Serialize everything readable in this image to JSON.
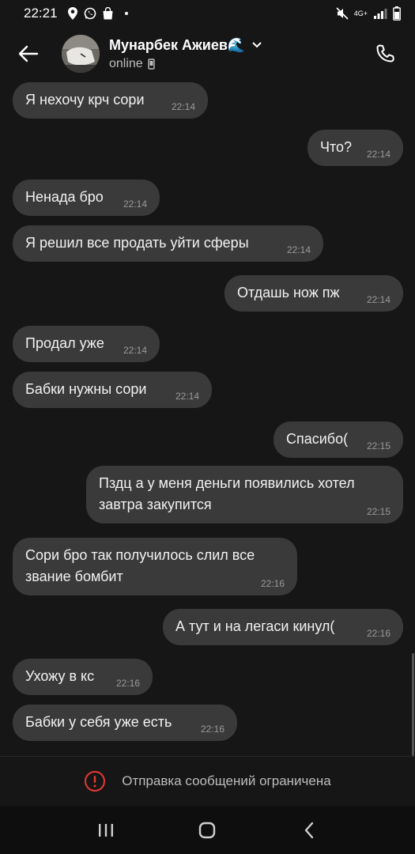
{
  "status_bar": {
    "time": "22:21",
    "network": "4G+"
  },
  "header": {
    "contact_name": "Мунарбек Ажиев🌊",
    "status": "online"
  },
  "messages": [
    {
      "side": "in",
      "text": "Я нехочу крч сори",
      "time": "22:14"
    },
    {
      "side": "out",
      "text": "Что?",
      "time": "22:14"
    },
    {
      "side": "in",
      "text": "Ненада бро",
      "time": "22:14"
    },
    {
      "side": "in",
      "text": "Я решил все продать уйти сферы",
      "time": "22:14"
    },
    {
      "side": "out",
      "text": "Отдашь нож пж",
      "time": "22:14"
    },
    {
      "side": "in",
      "text": "Продал уже",
      "time": "22:14"
    },
    {
      "side": "in",
      "text": "Бабки нужны сори",
      "time": "22:14"
    },
    {
      "side": "out",
      "text": "Спасибо(",
      "time": "22:15"
    },
    {
      "side": "out",
      "text": "Пздц а у меня деньги появились хотел завтра закупится",
      "time": "22:15"
    },
    {
      "side": "in",
      "text": "Сори бро так получилось слил все звание бомбит",
      "time": "22:16"
    },
    {
      "side": "out",
      "text": "А тут и на легаси кинул(",
      "time": "22:16"
    },
    {
      "side": "in",
      "text": "Ухожу в кс",
      "time": "22:16"
    },
    {
      "side": "in",
      "text": "Бабки у себя уже есть",
      "time": "22:16"
    }
  ],
  "restricted_notice": "Отправка сообщений ограничена",
  "colors": {
    "background": "#161616",
    "bubble": "#3a3a3a",
    "warning": "#e53935"
  }
}
